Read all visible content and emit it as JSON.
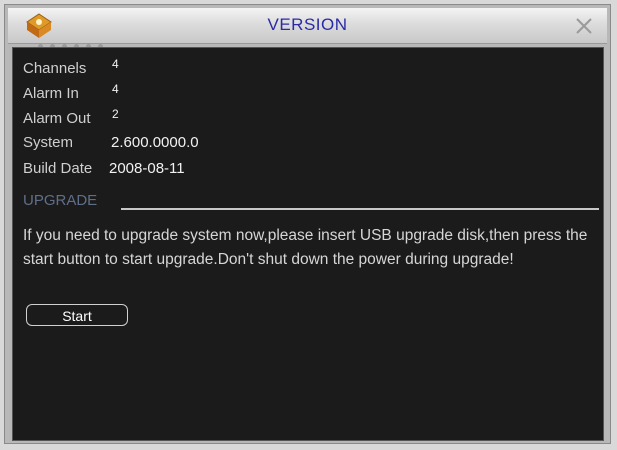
{
  "window": {
    "title": "VERSION",
    "logo_icon": "dvr-logo-icon",
    "close_icon": "close-icon"
  },
  "info": {
    "rows": [
      {
        "label": "Channels",
        "value": "4"
      },
      {
        "label": "Alarm In",
        "value": "4"
      },
      {
        "label": "Alarm Out",
        "value": "2"
      },
      {
        "label": "System",
        "value": "2.600.0000.0"
      },
      {
        "label": "Build Date",
        "value": "2008-08-11"
      }
    ]
  },
  "upgrade": {
    "heading": "UPGRADE",
    "message": "If you need to upgrade system now,please insert USB upgrade disk,then press the start button to start upgrade.Don't shut down the power during upgrade!",
    "start_label": "Start"
  },
  "colors": {
    "title_text": "#2a2aa8",
    "panel_bg": "#1b1b1b",
    "frame_bg": "#b8b8b8",
    "upgrade_heading": "#5f6f8a"
  }
}
